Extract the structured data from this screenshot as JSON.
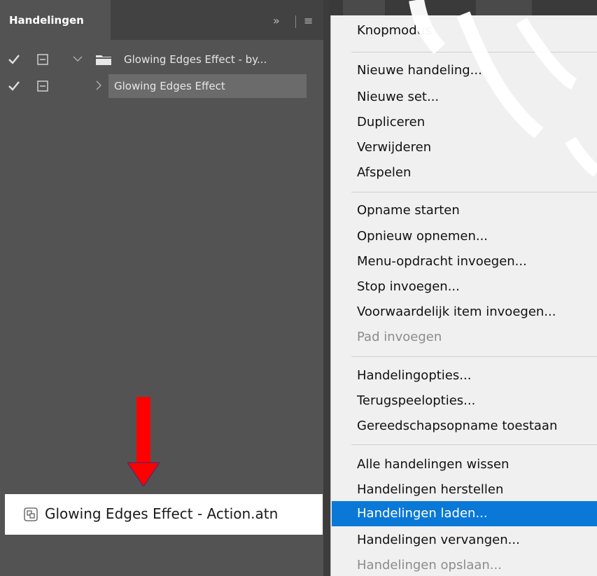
{
  "panel": {
    "tab_label": "Handelingen",
    "collapse_glyph": "»",
    "menu_glyph": "≡",
    "rows": [
      {
        "label": "Glowing Edges Effect - by...",
        "type": "set",
        "checked": true
      },
      {
        "label": "Glowing Edges  Effect",
        "type": "action",
        "checked": true
      }
    ]
  },
  "file": {
    "icon": "file-atn-icon",
    "label": "Glowing Edges Effect - Action.atn"
  },
  "menu": {
    "items": [
      {
        "label": "Knopmodus"
      },
      {
        "label": "Nieuwe handeling..."
      },
      {
        "label": "Nieuwe set..."
      },
      {
        "label": "Dupliceren"
      },
      {
        "label": "Verwijderen"
      },
      {
        "label": "Afspelen"
      },
      {
        "label": "Opname starten"
      },
      {
        "label": "Opnieuw opnemen..."
      },
      {
        "label": "Menu-opdracht invoegen..."
      },
      {
        "label": "Stop invoegen..."
      },
      {
        "label": "Voorwaardelijk item invoegen..."
      },
      {
        "label": "Pad invoegen",
        "disabled": true
      },
      {
        "label": "Handelingopties..."
      },
      {
        "label": "Terugspeelopties..."
      },
      {
        "label": "Gereedschapsopname toestaan"
      },
      {
        "label": "Alle handelingen wissen"
      },
      {
        "label": "Handelingen herstellen"
      },
      {
        "label": "Handelingen laden...",
        "highlighted": true
      },
      {
        "label": "Handelingen vervangen..."
      },
      {
        "label": "Handelingen opslaan...",
        "disabled": true
      }
    ]
  },
  "colors": {
    "panel_bg": "#535353",
    "header_bg": "#424242",
    "selection_bg": "#6b6b6b",
    "menu_bg": "#f0f0f0",
    "menu_highlight": "#0a78d7",
    "arrow": "#ff0000"
  }
}
